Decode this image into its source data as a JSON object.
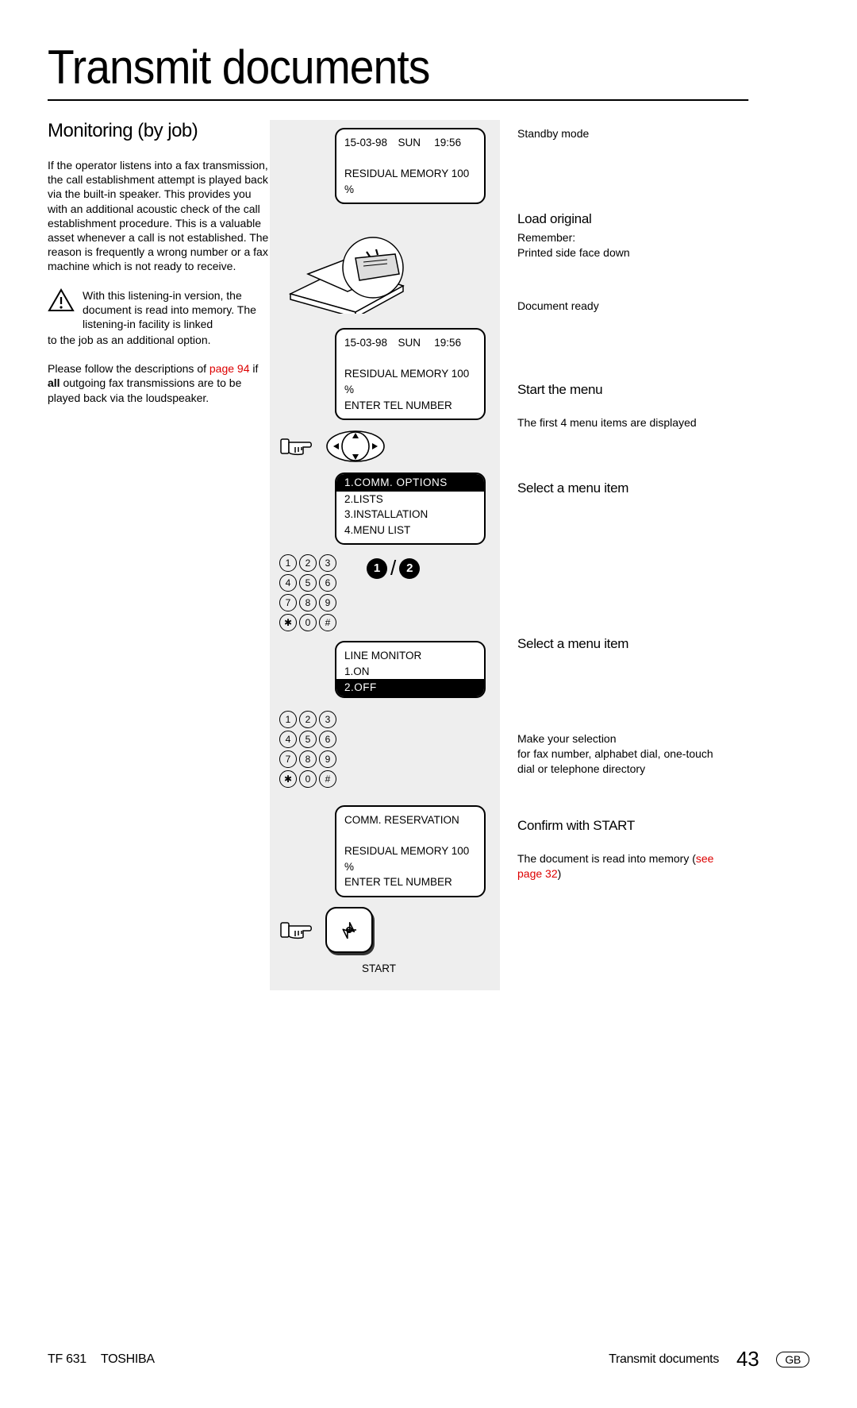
{
  "pageTitle": "Transmit documents",
  "subtitle": "Monitoring (by job)",
  "bodyPara1": "If the operator listens into a fax transmission, the call establishment attempt is played back via the built-in speaker. This provides you with an additional acoustic check of the call establishment procedure. This is a valuable asset whenever a call is not established. The reason is frequently a wrong number or a fax machine which is not ready to receive.",
  "warnIndented": "With this listening-in version, the document is read into memory. The listening-in facility is linked",
  "warnRest": "to the job as an additional option.",
  "para2a": "Please follow the descriptions of ",
  "para2link": "page 94",
  "para2b": " if ",
  "para2bold": "all",
  "para2c": " outgoing fax transmissions are to be played back via the loudspeaker.",
  "lcd1": {
    "l1": "15-03-98 SUN  19:56",
    "l3": "RESIDUAL MEMORY 100 %"
  },
  "lcd2": {
    "l1": "15-03-98 SUN  19:56",
    "l3": "RESIDUAL MEMORY 100 %",
    "l4": "ENTER TEL NUMBER"
  },
  "lcd3": {
    "hl": "1.COMM. OPTIONS",
    "l2": "2.LISTS",
    "l3": "3.INSTALLATION",
    "l4": "4.MENU LIST"
  },
  "lcd4": {
    "l1": "LINE MONITOR",
    "l2": "1.ON",
    "hl": "2.OFF"
  },
  "lcd5": {
    "l1": "COMM. RESERVATION",
    "l3": "RESIDUAL MEMORY 100 %",
    "l4": "ENTER TEL NUMBER"
  },
  "keypad": [
    "1",
    "2",
    "3",
    "4",
    "5",
    "6",
    "7",
    "8",
    "9",
    "✱",
    "0",
    "#"
  ],
  "selNum1": "1",
  "selNum2": "2",
  "startLabel": "START",
  "right": {
    "s1": "Standby mode",
    "s2t": "Load original",
    "s2a": "Remember:",
    "s2b": "Printed side face down",
    "s3": "Document ready",
    "s4t": "Start the menu",
    "s4b": "The first 4 menu items are displayed",
    "s5": "Select a menu item",
    "s6": "Select a menu item",
    "s7a": "Make your selection",
    "s7b": "for fax number, alphabet dial, one-touch dial or telephone directory",
    "s8t": "Confirm with START",
    "s8a": "The document is read into memory (",
    "s8link": "see page 32",
    "s8b": ")"
  },
  "footer": {
    "model": "TF 631",
    "brand": "TOSHIBA",
    "section": "Transmit documents",
    "page": "43",
    "lang": "GB"
  }
}
